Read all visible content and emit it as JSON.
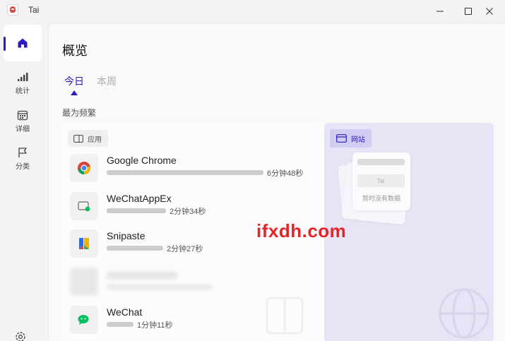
{
  "window": {
    "title": "Tai",
    "logo_icon": "tai-logo-icon",
    "controls": [
      "minimize-icon",
      "maximize-icon",
      "close-icon"
    ]
  },
  "sidebar": {
    "items": [
      {
        "label": "",
        "icon": "home-icon",
        "active": true
      },
      {
        "label": "统计",
        "icon": "bar-chart-icon",
        "active": false
      },
      {
        "label": "详细",
        "icon": "calendar-icon",
        "active": false
      },
      {
        "label": "分类",
        "icon": "flag-icon",
        "active": false
      }
    ],
    "settings_icon": "gear-icon"
  },
  "page": {
    "title": "概览",
    "tabs": [
      {
        "label": "今日",
        "active": true
      },
      {
        "label": "本周",
        "active": false
      }
    ],
    "section_title": "最为频繁"
  },
  "apps_panel": {
    "chip_label": "应用",
    "chip_icon": "window-icon",
    "rows": [
      {
        "name": "Google Chrome",
        "time": "6分钟48秒",
        "icon": "chrome-icon",
        "fraction": 1.0
      },
      {
        "name": "WeChatAppEx",
        "time": "2分钟34秒",
        "icon": "wechat-appex-icon",
        "fraction": 0.38
      },
      {
        "name": "Snipaste",
        "time": "2分钟27秒",
        "icon": "snipaste-icon",
        "fraction": 0.36
      },
      {
        "name": "WeChat",
        "time": "1分钟11秒",
        "icon": "wechat-icon",
        "fraction": 0.17
      }
    ]
  },
  "web_panel": {
    "chip_label": "网站",
    "chip_icon": "browser-window-icon",
    "placeholder_badge": "Tai",
    "empty_text": "暂时没有数据"
  },
  "watermark": "ifxdh.com",
  "colors": {
    "accent": "#2a1dbf",
    "web_panel_bg": "#e6e4f5",
    "watermark": "#e8232a"
  }
}
